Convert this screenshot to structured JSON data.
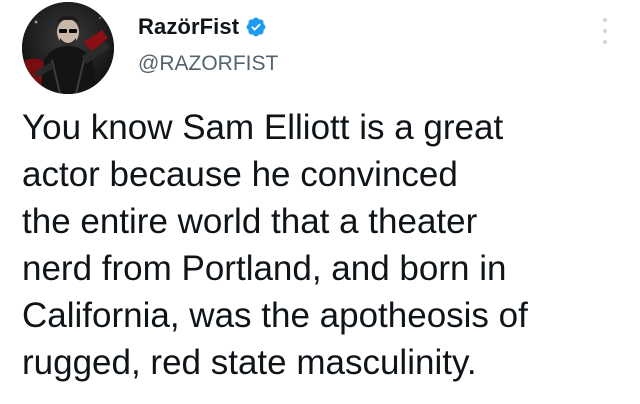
{
  "author": {
    "display_name": "RazörFist",
    "handle": "@RAZORFIST",
    "verified": true,
    "avatar_icon": "avatar-photo",
    "verified_icon": "verified-badge-icon",
    "verified_color": "#1d9bf0"
  },
  "menu": {
    "icon": "more-options-icon"
  },
  "tweet": {
    "lines": [
      "You know Sam Elliott is a great",
      "actor because he convinced",
      "the entire world that a theater",
      "nerd from Portland, and born in",
      "California, was the apotheosis of",
      "rugged, red state masculinity."
    ]
  },
  "colors": {
    "text": "#0f1419",
    "secondary": "#536471",
    "background": "#ffffff"
  }
}
